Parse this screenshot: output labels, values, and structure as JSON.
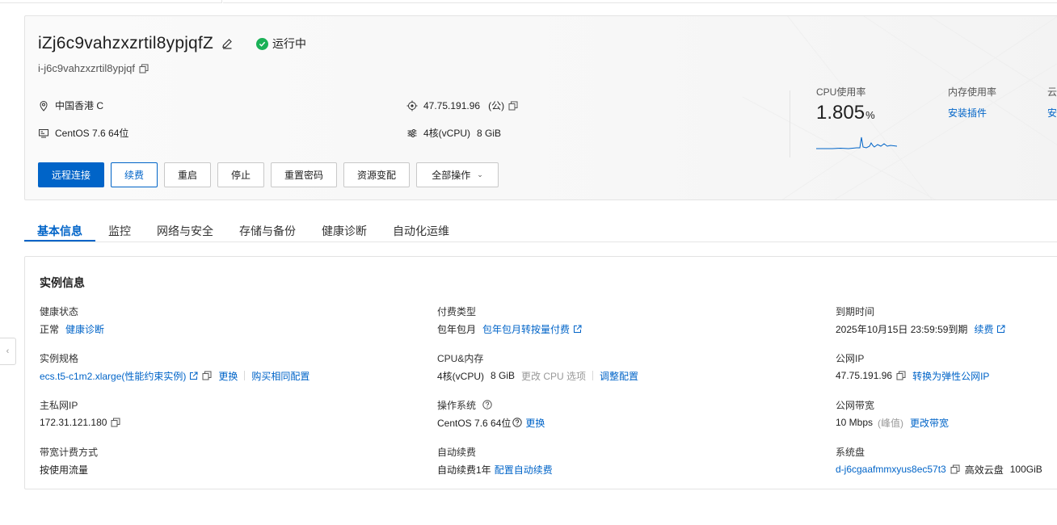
{
  "instance": {
    "name": "iZj6c9vahzxzrtil8ypjqfZ",
    "id": "i-j6c9vahzxzrtil8ypjqf",
    "status": "运行中",
    "region": "中国香港 C",
    "os": "CentOS 7.6 64位",
    "ip": "47.75.191.96",
    "ip_suffix": "(公)",
    "cpu": "4核(vCPU)",
    "memory": "8 GiB"
  },
  "actions": [
    {
      "label": "远程连接"
    },
    {
      "label": "续费"
    },
    {
      "label": "重启"
    },
    {
      "label": "停止"
    },
    {
      "label": "重置密码"
    },
    {
      "label": "资源变配"
    },
    {
      "label": "全部操作"
    }
  ],
  "metrics": {
    "cpu_label": "CPU使用率",
    "cpu_value": "1.805",
    "cpu_unit": "%",
    "mem_label": "内存使用率",
    "mem_link": "安装插件",
    "cloud_label": "云",
    "cloud_link": "安"
  },
  "tabs": [
    "基本信息",
    "监控",
    "网络与安全",
    "存储与备份",
    "健康诊断",
    "自动化运维"
  ],
  "info": {
    "title": "实例信息",
    "health_label": "健康状态",
    "health_value": "正常",
    "health_link": "健康诊断",
    "pay_label": "付费类型",
    "pay_value": "包年包月",
    "pay_link": "包年包月转按量付费",
    "expire_label": "到期时间",
    "expire_value": "2025年10月15日 23:59:59到期",
    "expire_link": "续费",
    "spec_label": "实例规格",
    "spec_link": "ecs.t5-c1m2.xlarge(性能约束实例)",
    "spec_change": "更换",
    "spec_buy": "购买相同配置",
    "cpumem_label": "CPU&内存",
    "cpumem_cpu": "4核(vCPU)",
    "cpumem_mem": "8 GiB",
    "cpumem_disabled": "更改 CPU 选项",
    "cpumem_link": "调整配置",
    "pubip_label": "公网IP",
    "pubip_value": "47.75.191.96",
    "pubip_link": "转换为弹性公网IP",
    "privip_label": "主私网IP",
    "privip_value": "172.31.121.180",
    "os_label": "操作系统",
    "os_value": "CentOS 7.6 64位",
    "os_link": "更换",
    "bw_label": "公网带宽",
    "bw_value": "10 Mbps",
    "bw_note": "(峰值)",
    "bw_link": "更改带宽",
    "bwbill_label": "带宽计费方式",
    "bwbill_value": "按使用流量",
    "renew_label": "自动续费",
    "renew_value": "自动续费1年",
    "renew_link": "配置自动续费",
    "disk_label": "系统盘",
    "disk_link": "d-j6cgaafmmxyus8ec57t3",
    "disk_type": "高效云盘",
    "disk_size": "100GiB"
  },
  "colors": {
    "primary": "#0064c8",
    "running": "#1bb157"
  }
}
